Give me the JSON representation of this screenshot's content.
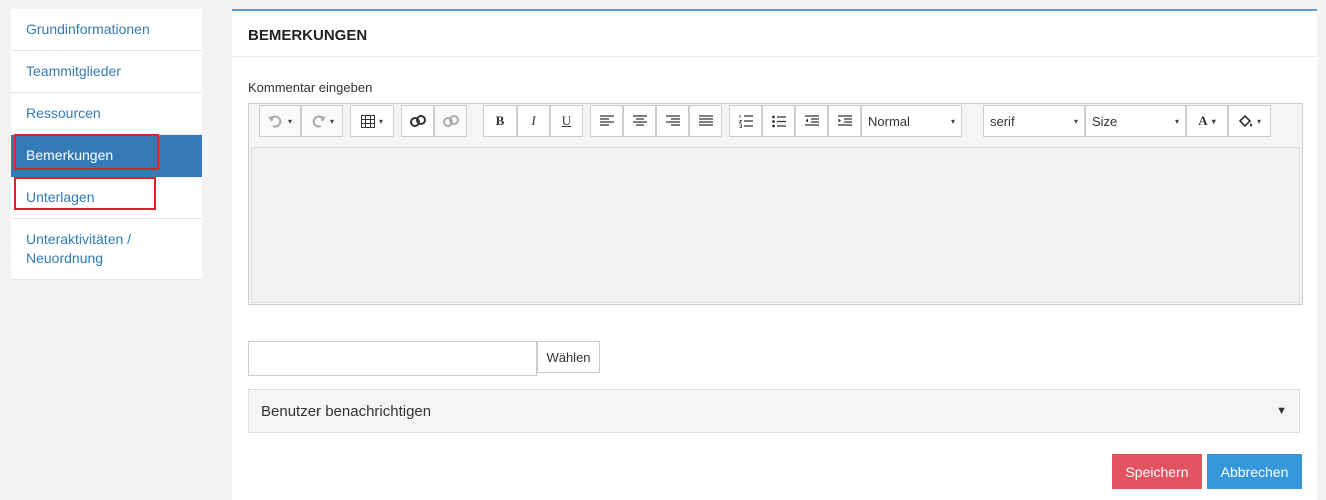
{
  "sidebar": {
    "items": [
      {
        "label": "Grundinformationen"
      },
      {
        "label": "Teammitglieder"
      },
      {
        "label": "Ressourcen"
      },
      {
        "label": "Bemerkungen"
      },
      {
        "label": "Unterlagen"
      },
      {
        "label": "Unteraktivitäten / Neuordnung"
      }
    ]
  },
  "panel": {
    "title": "BEMERKUNGEN",
    "comment_label": "Kommentar eingeben",
    "toolbar": {
      "format_value": "Normal",
      "font_value": "serif",
      "size_value": "Size",
      "bold": "B",
      "italic": "I",
      "underline": "U",
      "font_color": "A"
    },
    "file": {
      "value": "",
      "button": "Wählen"
    },
    "notify": {
      "label": "Benutzer benachrichtigen",
      "caret": "▼"
    },
    "buttons": {
      "save": "Speichern",
      "cancel": "Abbrechen"
    }
  },
  "colors": {
    "primary": "#337ab7",
    "danger": "#e35261",
    "info": "#3698db",
    "highlight": "#d9232f"
  }
}
